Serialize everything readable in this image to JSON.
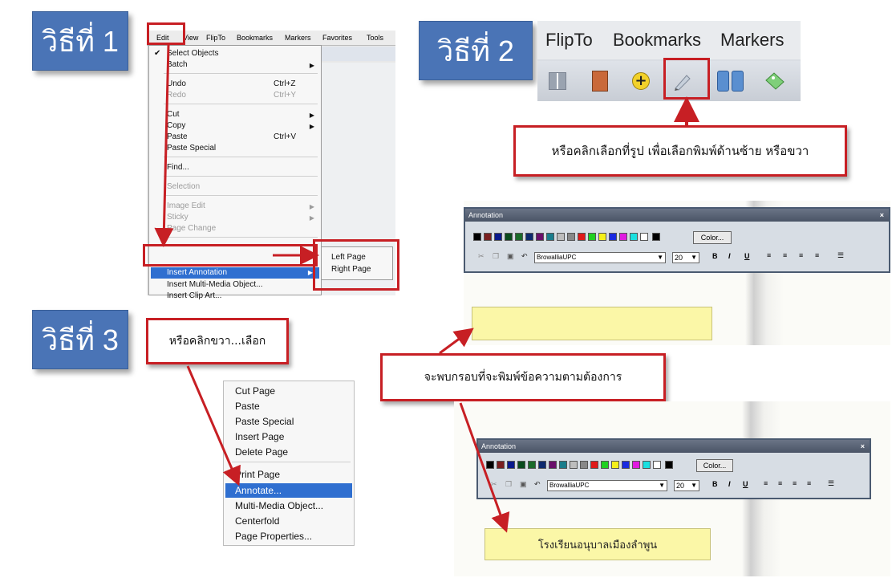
{
  "steps": {
    "step1": "วิธีที่ 1",
    "step2": "วิธีที่ 2",
    "step3": "วิธีที่ 3"
  },
  "menubar1": [
    "Edit",
    "View",
    "FlipTo",
    "Bookmarks",
    "Markers",
    "Favorites",
    "Tools"
  ],
  "edit_menu": {
    "items": [
      {
        "label": "Select Objects",
        "shortcut": ""
      },
      {
        "label": "Batch",
        "shortcut": ""
      },
      {
        "label": "Undo",
        "shortcut": "Ctrl+Z"
      },
      {
        "label": "Redo",
        "shortcut": "Ctrl+Y"
      },
      {
        "label": "Cut",
        "shortcut": ""
      },
      {
        "label": "Copy",
        "shortcut": ""
      },
      {
        "label": "Paste",
        "shortcut": "Ctrl+V"
      },
      {
        "label": "Paste Special",
        "shortcut": ""
      },
      {
        "label": "Find...",
        "shortcut": ""
      },
      {
        "label": "Selection",
        "shortcut": ""
      },
      {
        "label": "Image Edit",
        "shortcut": ""
      },
      {
        "label": "Sticky",
        "shortcut": ""
      },
      {
        "label": "Page Change",
        "shortcut": ""
      },
      {
        "label": "Insert Annotation",
        "shortcut": ""
      },
      {
        "label": "Insert Multi-Media Object...",
        "shortcut": ""
      },
      {
        "label": "Insert Clip Art...",
        "shortcut": ""
      }
    ],
    "submenu": [
      "Left Page",
      "Right Page"
    ]
  },
  "menubar2": [
    "FlipTo",
    "Bookmarks",
    "Markers"
  ],
  "callouts": {
    "step2_tip": "หรือคลิกเลือกที่รูป เพื่อเลือกพิมพ์ด้านซ้าย หรือขวา",
    "step3_tip": "หรือคลิกขวา...เลือก",
    "textbox_tip": "จะพบกรอบที่จะพิมพ์ข้อความตามต้องการ"
  },
  "annotation_panel": {
    "title": "Annotation",
    "close": "×",
    "color_button": "Color...",
    "font": "BrowalliaUPC",
    "size": "20",
    "format_buttons": [
      "B",
      "I",
      "U"
    ],
    "swatches": [
      "#000000",
      "#7a1f1f",
      "#0a1a8c",
      "#0a4b1d",
      "#1b6b2a",
      "#0e2a6e",
      "#6a0f6a",
      "#1a7d8c",
      "#bdbdbd",
      "#888888",
      "#e01a1a",
      "#20d020",
      "#f5f01a",
      "#1a2ae0",
      "#e01ae0",
      "#1ae0e0",
      "#ffffff",
      "#000000"
    ]
  },
  "context_menu": [
    "Cut Page",
    "Paste",
    "Paste Special",
    "Insert Page",
    "Delete Page",
    "Print Page",
    "Annotate...",
    "Multi-Media Object...",
    "Centerfold",
    "Page Properties..."
  ],
  "note_text": "โรงเรียนอนุบาลเมืองลำพูน",
  "colors": {
    "badge": "#4a74b6",
    "callout_border": "#c71f24",
    "note": "#fbf7a7",
    "menu_highlight": "#2f6fd0"
  }
}
